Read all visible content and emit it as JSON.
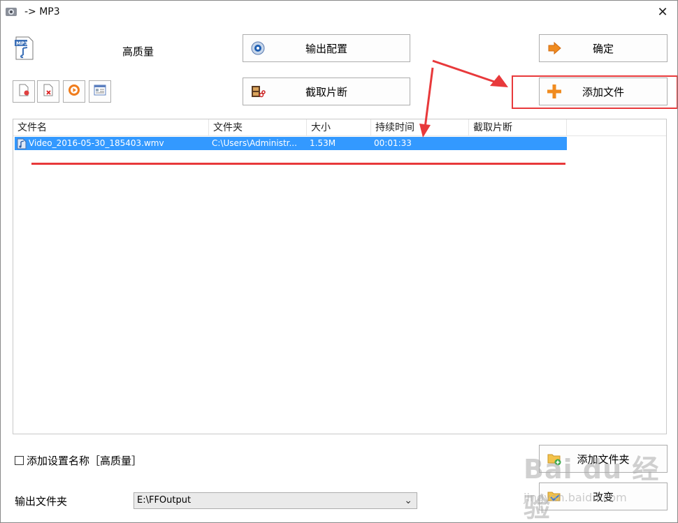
{
  "window": {
    "title": "-> MP3",
    "close_glyph": "✕"
  },
  "profile": {
    "quality_label": "高质量",
    "icon": "mp3-file-icon"
  },
  "buttons": {
    "output_config": "输出配置",
    "clip_main": "截取片断",
    "ok": "确定",
    "add_file": "添加文件",
    "add_folder": "添加文件夹",
    "change": "改变"
  },
  "list": {
    "columns": [
      "文件名",
      "文件夹",
      "大小",
      "持续时间",
      "截取片断"
    ],
    "rows": [
      {
        "name": "Video_2016-05-30_185403.wmv",
        "folder": "C:\\Users\\Administr...",
        "size": "1.53M",
        "duration": "00:01:33",
        "clip": ""
      }
    ],
    "selected_row_color": "#3399ff"
  },
  "options": {
    "add_setting_name_label": "添加设置名称［高质量］",
    "checked": false
  },
  "output": {
    "folder_label": "输出文件夹",
    "folder_value": "E:\\FFOutput"
  },
  "colors": {
    "annotation_red": "#e8393b"
  },
  "watermark": {
    "text": "Bai du 经验",
    "sub": "jingyan.baidu.com"
  }
}
